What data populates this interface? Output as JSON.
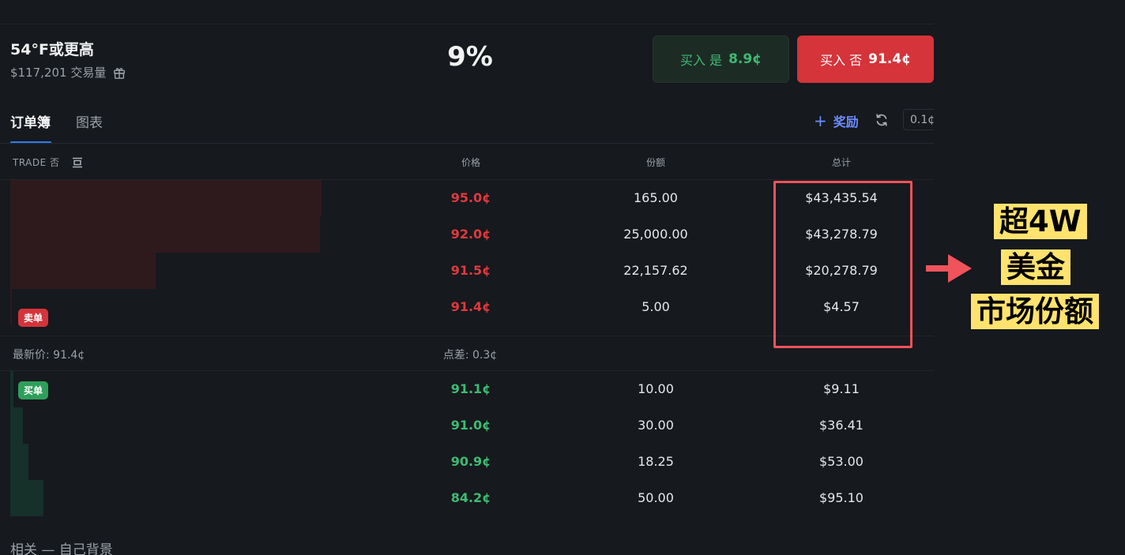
{
  "market": {
    "title": "54°F或更高",
    "volume": "$117,201 交易量",
    "probability": "9%"
  },
  "actions": {
    "buy_yes_label": "买入 是",
    "buy_yes_price": "8.9¢",
    "buy_no_label": "买入 否",
    "buy_no_price": "91.4¢"
  },
  "tabs": {
    "orderbook": "订单簿",
    "chart": "图表"
  },
  "toolbar": {
    "rewards_plus": "+",
    "rewards_label": "奖励",
    "tick_size": "0.1¢"
  },
  "columns": {
    "trade": "TRADE 否",
    "price": "价格",
    "shares": "份额",
    "total": "总计"
  },
  "asks": [
    {
      "price": "95.0¢",
      "shares": "165.00",
      "total": "$43,435.54",
      "depth": 0.985
    },
    {
      "price": "92.0¢",
      "shares": "25,000.00",
      "total": "$43,278.79",
      "depth": 0.98
    },
    {
      "price": "91.5¢",
      "shares": "22,157.62",
      "total": "$20,278.79",
      "depth": 0.46
    },
    {
      "price": "91.4¢",
      "shares": "5.00",
      "total": "$4.57",
      "depth": 0.0025
    }
  ],
  "bids": [
    {
      "price": "91.1¢",
      "shares": "10.00",
      "total": "$9.11",
      "depth": 0.01
    },
    {
      "price": "91.0¢",
      "shares": "30.00",
      "total": "$36.41",
      "depth": 0.04
    },
    {
      "price": "90.9¢",
      "shares": "18.25",
      "total": "$53.00",
      "depth": 0.058
    },
    {
      "price": "84.2¢",
      "shares": "50.00",
      "total": "$95.10",
      "depth": 0.105
    }
  ],
  "badges": {
    "ask": "卖单",
    "bid": "买单"
  },
  "summary": {
    "last_price": "最新价: 91.4¢",
    "spread": "点差: 0.3¢"
  },
  "footer": {
    "cut_text": "相关 — 自己背景"
  },
  "annotation": {
    "line1": "超4W",
    "line2": "美金",
    "line3": "市场份额",
    "box_color": "#f0535c",
    "highlight_color": "#ffe36e"
  },
  "colors": {
    "background": "#16191d",
    "ask_red": "#e0393e",
    "bid_green": "#3dbb73",
    "accent_blue": "#2d7cf0",
    "rewards_blue": "#6d8dff"
  },
  "icons": [
    "gift-icon",
    "refresh-icon",
    "layout-icon",
    "arrow-right-icon"
  ]
}
